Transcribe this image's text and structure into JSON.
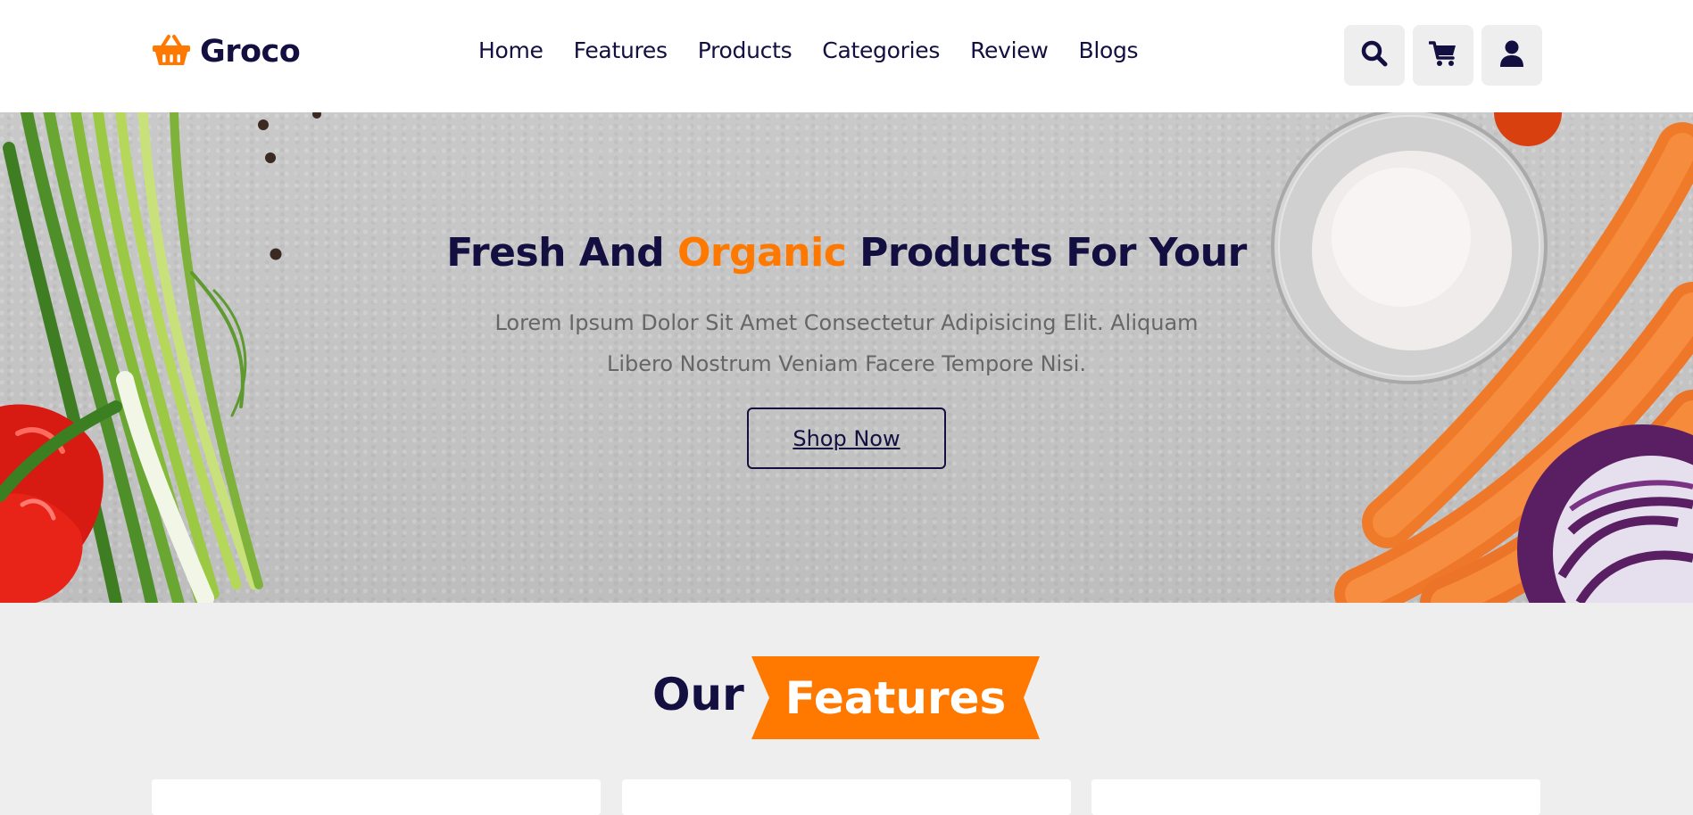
{
  "header": {
    "logo_text": "Groco",
    "logo_icon": "basket-icon",
    "nav": [
      {
        "label": "Home"
      },
      {
        "label": "Features"
      },
      {
        "label": "Products"
      },
      {
        "label": "Categories"
      },
      {
        "label": "Review"
      },
      {
        "label": "Blogs"
      }
    ],
    "icons": [
      "search-icon",
      "cart-icon",
      "user-icon"
    ]
  },
  "hero": {
    "title_part1": "Fresh And ",
    "title_accent": "Organic",
    "title_part2": " Products For Your",
    "description": "Lorem Ipsum Dolor Sit Amet Consectetur Adipisicing Elit. Aliquam Libero Nostrum Veniam Facere Tempore Nisi.",
    "cta_label": "Shop Now"
  },
  "features": {
    "heading_plain": "Our",
    "heading_accent": "Features"
  },
  "colors": {
    "brand_dark": "#130f40",
    "accent": "#ff7800",
    "text_muted": "#666666",
    "background": "#eeeeee"
  }
}
